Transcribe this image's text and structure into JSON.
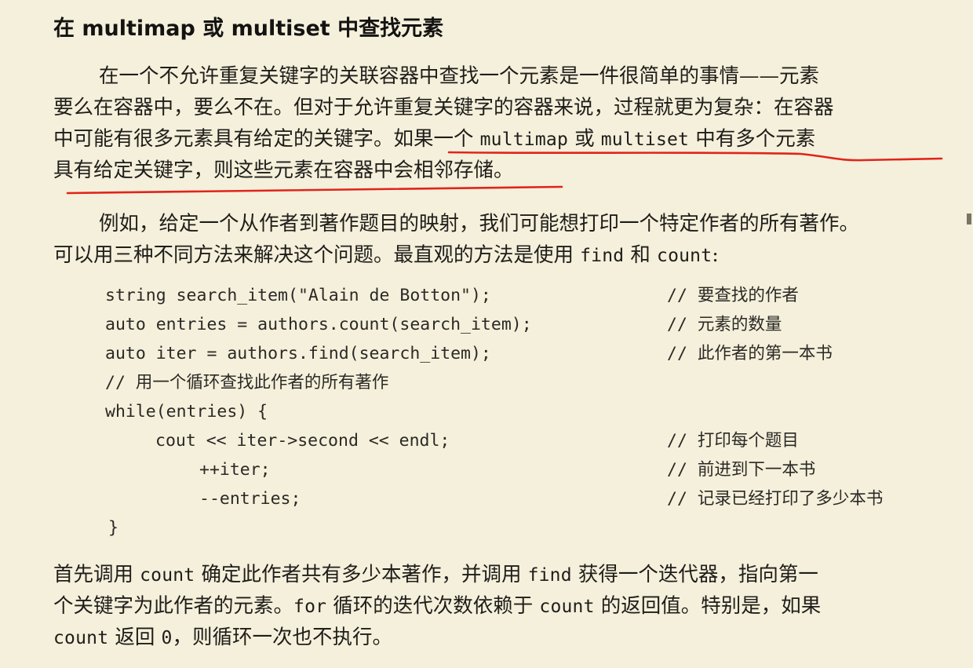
{
  "heading": "在 multimap 或 multiset 中查找元素",
  "para1": {
    "l1": "在一个不允许重复关键字的关联容器中查找一个元素是一件很简单的事情——元素",
    "l2": "要么在容器中，要么不在。但对于允许重复关键字的容器来说，过程就更为复杂：在容器",
    "l3a": "中可能有很多元素具有给定的关键字。如果一个 ",
    "l3b": "multimap",
    "l3c": " 或 ",
    "l3d": "multiset",
    "l3e": " 中有多个元素",
    "l4": "具有给定关键字，则这些元素在容器中会相邻存储。"
  },
  "para2": {
    "l1": "例如，给定一个从作者到著作题目的映射，我们可能想打印一个特定作者的所有著作。",
    "l2a": "可以用三种不同方法来解决这个问题。最直观的方法是使用 ",
    "l2b": "find",
    "l2c": " 和 ",
    "l2d": "count",
    "l2e": ":"
  },
  "code": [
    {
      "text": "string search_item(\"Alain de Botton\");",
      "comment": "// 要查找的作者",
      "indent": 0
    },
    {
      "text": "auto entries = authors.count(search_item);",
      "comment": "// 元素的数量",
      "indent": 0
    },
    {
      "text": "auto iter = authors.find(search_item);",
      "comment": "// 此作者的第一本书",
      "indent": 0
    },
    {
      "text": "// 用一个循环查找此作者的所有著作",
      "comment": "",
      "indent": 0
    },
    {
      "text": "while(entries) {",
      "comment": "",
      "indent": 0
    },
    {
      "text": "cout << iter->second << endl;",
      "comment": "// 打印每个题目",
      "indent": 64
    },
    {
      "text": "++iter;",
      "comment": "// 前进到下一本书",
      "indent": 120
    },
    {
      "text": "--entries;",
      "comment": "// 记录已经打印了多少本书",
      "indent": 120
    },
    {
      "text": "}",
      "comment": "",
      "indent": 4
    }
  ],
  "para3": {
    "l1a": "首先调用 ",
    "l1b": "count",
    "l1c": " 确定此作者共有多少本著作，并调用 ",
    "l1d": "find",
    "l1e": " 获得一个迭代器，指向第一",
    "l2a": "个关键字为此作者的元素。",
    "l2b": "for",
    "l2c": " 循环的迭代次数依赖于 ",
    "l2d": "count",
    "l2e": " 的返回值。特别是，如果",
    "l3a": "count",
    "l3b": " 返回 ",
    "l3c": "0",
    "l3d": "，则循环一次也不执行。"
  },
  "colors": {
    "background": "#f5f0db",
    "text": "#1c1a17",
    "underline": "#e0241b"
  }
}
